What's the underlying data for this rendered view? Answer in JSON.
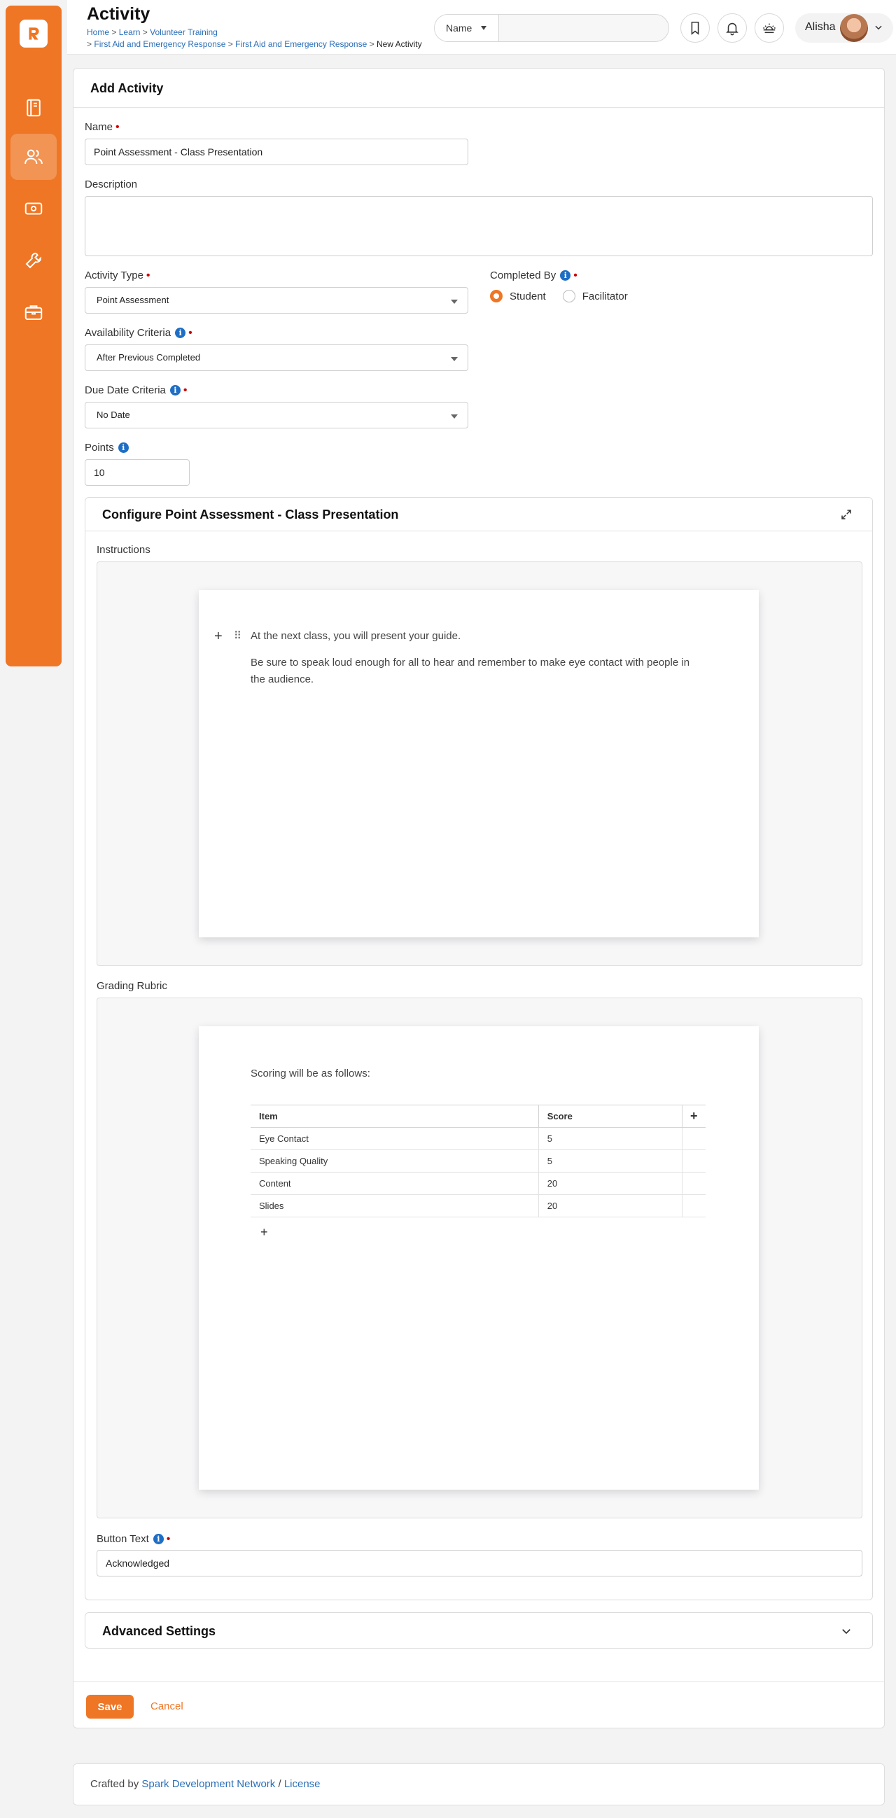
{
  "header": {
    "title": "Activity",
    "breadcrumbs": {
      "home": "Home",
      "learn": "Learn",
      "volunteer": "Volunteer Training",
      "program": "First Aid and Emergency Response",
      "course": "First Aid and Emergency Response",
      "current": "New Activity"
    },
    "search": {
      "scope": "Name",
      "value": ""
    },
    "user": {
      "name": "Alisha"
    }
  },
  "sidebar": {
    "items": [
      {
        "icon": "book-icon",
        "active": false
      },
      {
        "icon": "people-icon",
        "active": true
      },
      {
        "icon": "finance-icon",
        "active": false
      },
      {
        "icon": "wrench-icon",
        "active": false
      },
      {
        "icon": "briefcase-icon",
        "active": false
      }
    ]
  },
  "form": {
    "card_title": "Add Activity",
    "name_label": "Name",
    "name_value": "Point Assessment - Class Presentation",
    "description_label": "Description",
    "description_value": "",
    "activity_type_label": "Activity Type",
    "activity_type_value": "Point Assessment",
    "completed_by_label": "Completed By",
    "completed_by_options": [
      "Student",
      "Facilitator"
    ],
    "completed_by_selected": "Student",
    "availability_label": "Availability Criteria",
    "availability_value": "After Previous Completed",
    "due_date_label": "Due Date Criteria",
    "due_date_value": "No Date",
    "points_label": "Points",
    "points_value": "10"
  },
  "configure": {
    "title": "Configure Point Assessment - Class Presentation",
    "instructions_label": "Instructions",
    "instructions_p1": "At the next class, you will present your guide.",
    "instructions_p2": "Be sure to speak loud enough for all to hear and remember to make eye contact with people in the audience.",
    "rubric_label": "Grading Rubric",
    "rubric_intro": "Scoring will be as follows:",
    "rubric_columns": [
      "Item",
      "Score"
    ],
    "rubric_rows": [
      [
        "Eye Contact",
        "5"
      ],
      [
        "Speaking Quality",
        "5"
      ],
      [
        "Content",
        "20"
      ],
      [
        "Slides",
        "20"
      ]
    ],
    "button_text_label": "Button Text",
    "button_text_value": "Acknowledged"
  },
  "advanced": {
    "title": "Advanced Settings"
  },
  "actions": {
    "save": "Save",
    "cancel": "Cancel"
  },
  "footer": {
    "prefix": "Crafted by",
    "link": "Spark Development Network",
    "separator": "/",
    "license": "License"
  },
  "colors": {
    "brand": "#ee7625",
    "link": "#2c6fb7",
    "required": "#cc0000",
    "info": "#1e6ec5"
  }
}
